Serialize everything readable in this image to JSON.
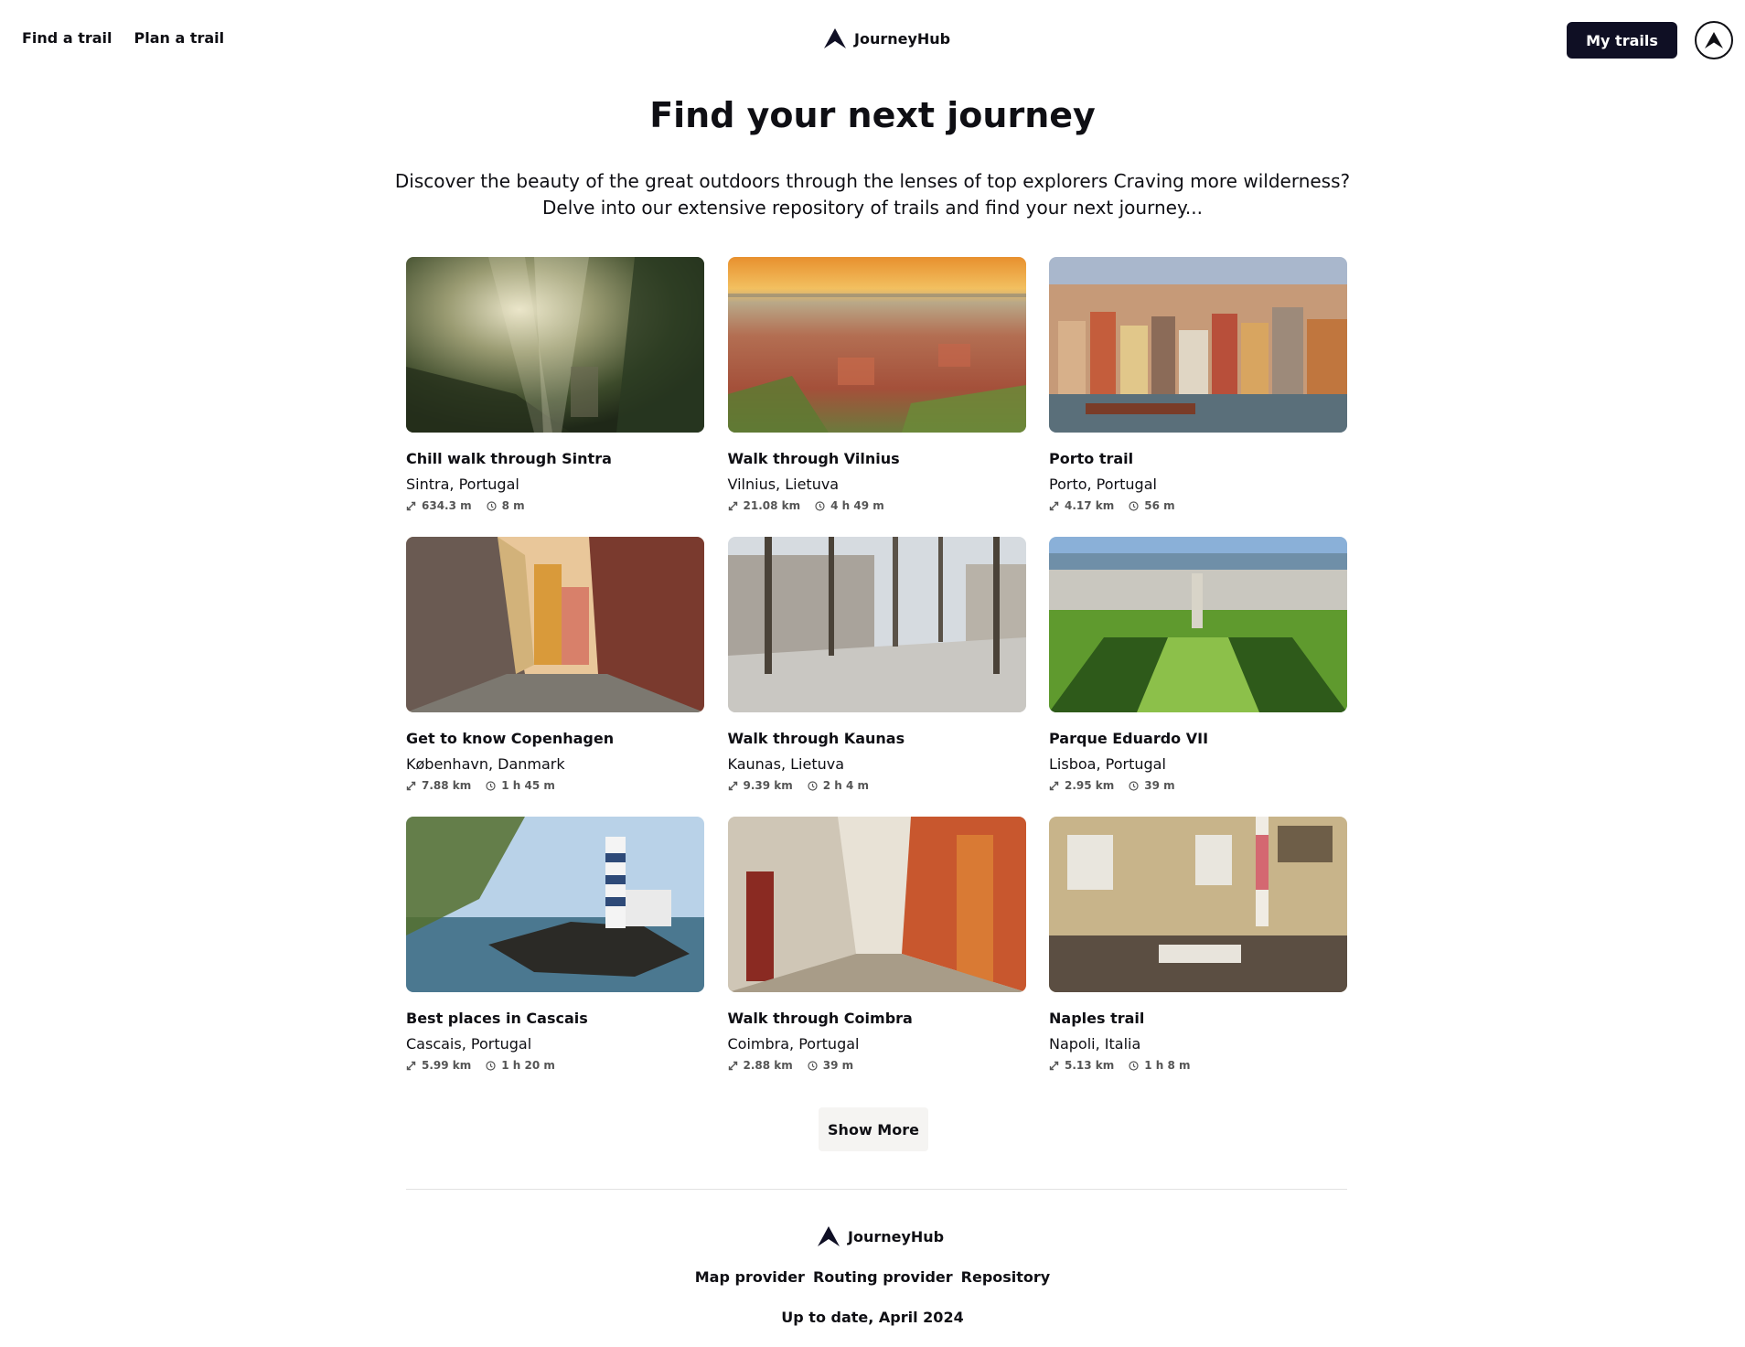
{
  "header": {
    "nav": [
      {
        "label": "Find a trail"
      },
      {
        "label": "Plan a trail"
      }
    ],
    "brand": "JourneyHub",
    "my_trails_label": "My trails",
    "logo_icon": "mountain-logo-icon",
    "avatar_icon": "user-avatar-icon"
  },
  "hero": {
    "title": "Find your next journey",
    "intro_line1": "Discover the beauty of the great outdoors through the lenses of top explorers Craving more wilderness?",
    "intro_line2": "Delve into our extensive repository of trails and find your next journey..."
  },
  "trails": [
    {
      "title": "Chill walk through Sintra",
      "location": "Sintra, Portugal",
      "distance": "634.3 m",
      "duration": "8 m",
      "image": "misty forest with sun rays"
    },
    {
      "title": "Walk through Vilnius",
      "location": "Vilnius, Lietuva",
      "distance": "21.08 km",
      "duration": "4 h 49 m",
      "image": "aerial city view at sunset"
    },
    {
      "title": "Porto trail",
      "location": "Porto, Portugal",
      "distance": "4.17 km",
      "duration": "56 m",
      "image": "colorful riverside houses"
    },
    {
      "title": "Get to know Copenhagen",
      "location": "København, Danmark",
      "distance": "7.88 km",
      "duration": "1 h 45 m",
      "image": "cobbled street with colored facades"
    },
    {
      "title": "Walk through Kaunas",
      "location": "Kaunas, Lietuva",
      "distance": "9.39 km",
      "duration": "2 h 4 m",
      "image": "tree lined pedestrian boulevard"
    },
    {
      "title": "Parque Eduardo VII",
      "location": "Lisboa, Portugal",
      "distance": "2.95 km",
      "duration": "39 m",
      "image": "formal park hedges"
    },
    {
      "title": "Best places in Cascais",
      "location": "Cascais, Portugal",
      "distance": "5.99 km",
      "duration": "1 h 20 m",
      "image": "striped lighthouse by the sea"
    },
    {
      "title": "Walk through Coimbra",
      "location": "Coimbra, Portugal",
      "distance": "2.88 km",
      "duration": "39 m",
      "image": "narrow old town alley"
    },
    {
      "title": "Naples trail",
      "location": "Napoli, Italia",
      "distance": "5.13 km",
      "duration": "1 h 8 m",
      "image": "building facade with pizzeria sign"
    }
  ],
  "show_more_label": "Show More",
  "footer": {
    "brand": "JourneyHub",
    "links": [
      {
        "label": "Map provider"
      },
      {
        "label": "Routing provider"
      },
      {
        "label": "Repository"
      }
    ],
    "note": "Up to date, April 2024"
  },
  "colors": {
    "primary_dark": "#0f0f24",
    "text": "#0f0f14",
    "muted": "#555555",
    "button_light": "#f5f4f2",
    "divider": "#e2e2e2"
  }
}
